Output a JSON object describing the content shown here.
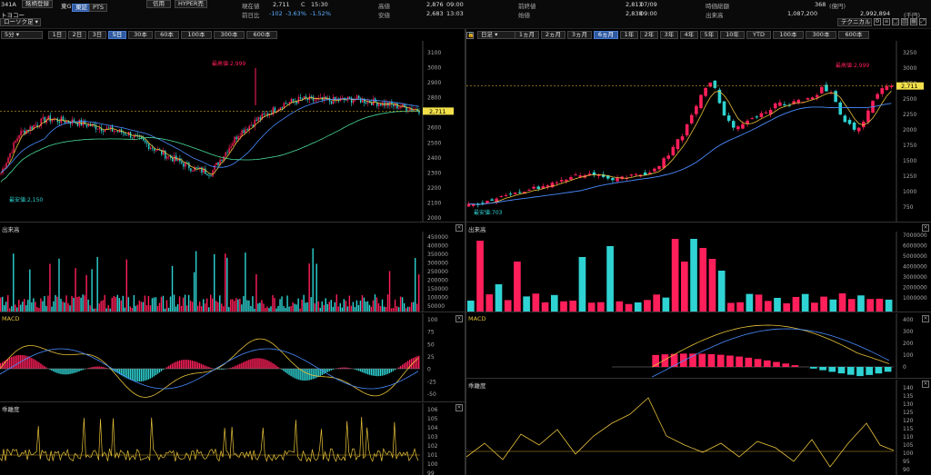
{
  "header": {
    "code": "341A",
    "btn_watchlist": "銘柄登録",
    "market_label": "東G",
    "btn_toshou": "東証",
    "btn_pts": "PTS",
    "company": "トヨコー",
    "btn_credit": "信用",
    "btn_hyper": "HYPER売",
    "price_label": "現在値",
    "price": "2,711",
    "price_flag": "C",
    "price_time": "15:30",
    "change_label": "前日比",
    "change": "-102",
    "change_pct": "-3.63%",
    "change_pct2": "-1.52%",
    "high_label": "高値",
    "high": "2,876",
    "high_time": "09:00",
    "low_label": "安値",
    "low": "2,683",
    "low_time": "13:03",
    "prev_close_label": "前終値",
    "prev_close": "2,813",
    "prev_close_date": "07/09",
    "open_label": "始値",
    "open": "2,838",
    "open_time": "09:00",
    "market_cap_label": "時価総額",
    "market_cap": "368",
    "market_cap_unit": "(億円)",
    "volume_label": "出来高",
    "volume": "1,087,200",
    "turnover": "2,992,894",
    "turnover_unit": "(千円)",
    "btn_technical": "テクニカル",
    "icons": [
      "gear-icon",
      "list-icon",
      "window-icon",
      "tile-icon",
      "grid-icon",
      "expand-icon"
    ],
    "candle_select": "ローソク足"
  },
  "left": {
    "interval_select": "5分",
    "range_tabs": [
      "1日",
      "2日",
      "3日",
      "5日",
      "30本",
      "60本",
      "100本",
      "300本",
      "600本"
    ],
    "active_range": "5日",
    "high_marker": "最高値:2,999",
    "low_marker": "最安値:2,150",
    "price_box": "2,711",
    "price_axis": [
      "3100",
      "3000",
      "2900",
      "2800",
      "2700",
      "2600",
      "2500",
      "2400",
      "2300",
      "2200",
      "2100",
      "2000"
    ],
    "volume_title": "出来高",
    "volume_axis": [
      "450000",
      "400000",
      "350000",
      "300000",
      "250000",
      "200000",
      "150000",
      "100000",
      "50000"
    ],
    "macd_title": "MACD",
    "macd_axis": [
      "100",
      "75",
      "50",
      "25",
      "0",
      "-25",
      "-50"
    ],
    "kairi_title": "乖離度",
    "kairi_axis": [
      "106",
      "105",
      "104",
      "103",
      "102",
      "101",
      "100",
      "99"
    ]
  },
  "right": {
    "interval_select": "日足",
    "range_tabs": [
      "1ヵ月",
      "2ヵ月",
      "3ヵ月",
      "6ヵ月",
      "1年",
      "2年",
      "3年",
      "4年",
      "5年",
      "10年",
      "YTD",
      "100本",
      "300本",
      "600本"
    ],
    "active_range": "6ヵ月",
    "high_marker": "最高値:2,999",
    "low_marker": "最安値:703",
    "price_box": "2,711",
    "price_axis": [
      "3250",
      "3000",
      "2750",
      "2500",
      "2250",
      "2000",
      "1750",
      "1500",
      "1250",
      "1000",
      "750"
    ],
    "volume_title": "出来高",
    "volume_axis": [
      "7000000",
      "6000000",
      "5000000",
      "4000000",
      "3000000",
      "2000000",
      "1000000"
    ],
    "macd_title": "MACD",
    "macd_axis": [
      "400",
      "300",
      "200",
      "100",
      "0"
    ],
    "kairi_title": "乖離度",
    "kairi_axis": [
      "140",
      "135",
      "130",
      "125",
      "120",
      "115",
      "110",
      "105",
      "100",
      "95",
      "90"
    ]
  },
  "colors": {
    "up": "#ff1f5a",
    "down": "#2fd3d3",
    "ma_short": "#e8c23a",
    "ma_mid": "#4a8cff",
    "ma_long": "#4adf9a",
    "accent": "#2f5aa0"
  }
}
